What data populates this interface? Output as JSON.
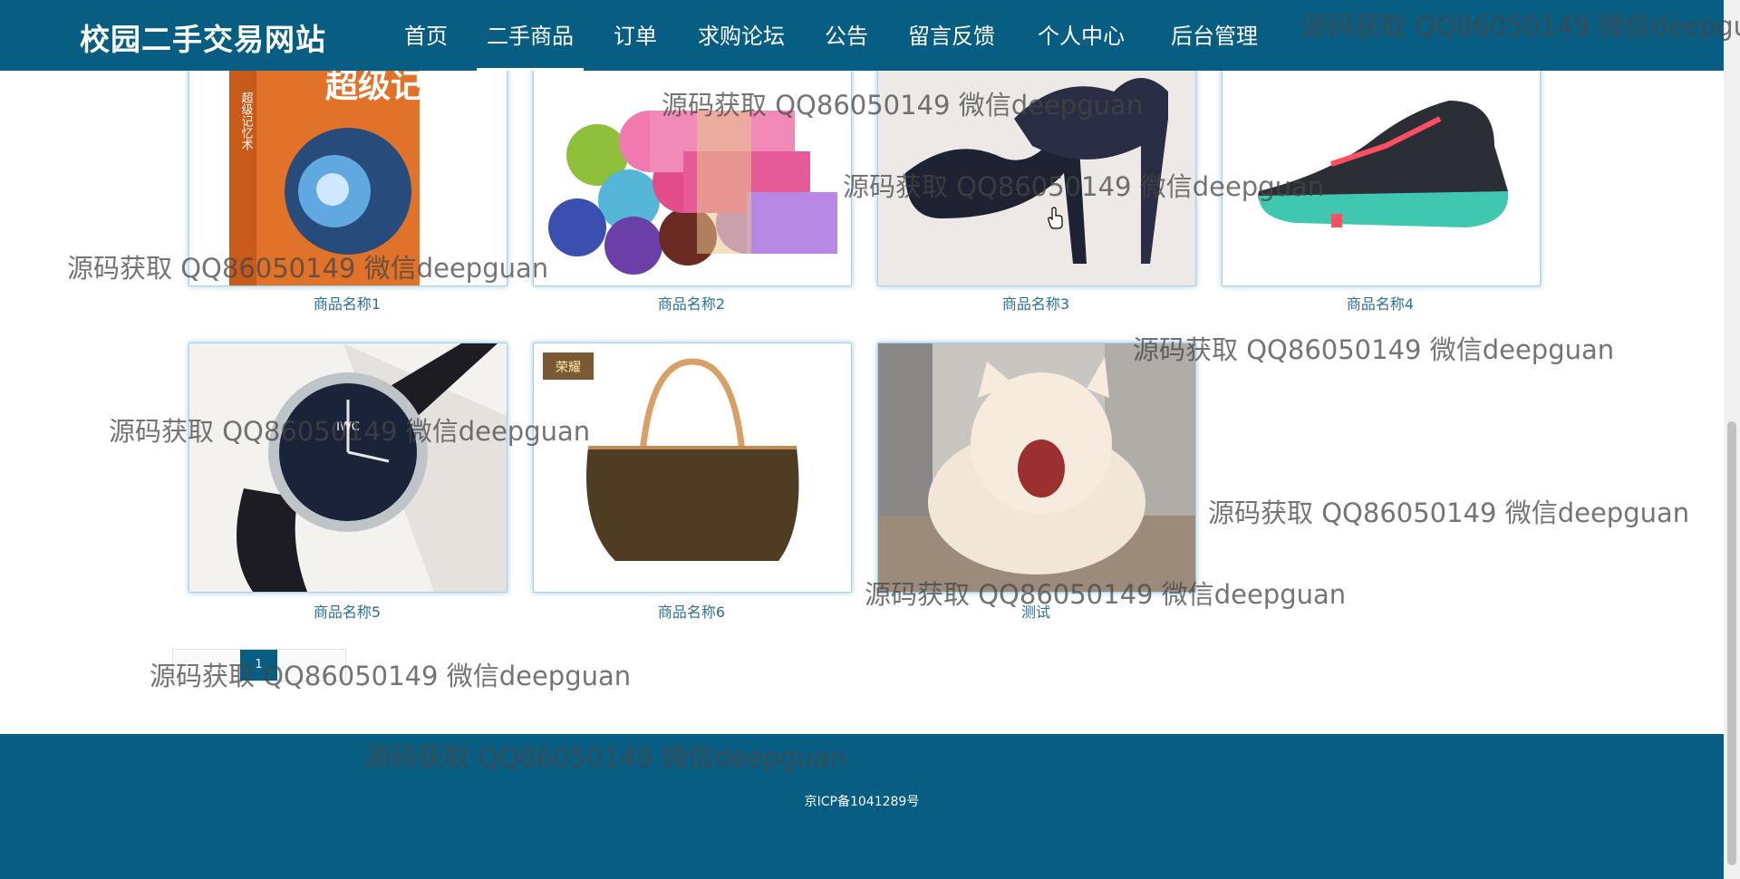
{
  "header": {
    "brand": "校园二手交易网站",
    "nav": [
      {
        "label": "首页"
      },
      {
        "label": "二手商品",
        "active": true
      },
      {
        "label": "订单"
      },
      {
        "label": "求购论坛"
      },
      {
        "label": "公告"
      },
      {
        "label": "留言反馈"
      },
      {
        "label": "个人中心"
      },
      {
        "label": "后台管理"
      }
    ]
  },
  "products": [
    {
      "name": "商品名称1",
      "image": "book-cover-image"
    },
    {
      "name": "商品名称2",
      "image": "yoga-mats-image"
    },
    {
      "name": "商品名称3",
      "image": "high-heels-image"
    },
    {
      "name": "商品名称4",
      "image": "sneaker-image"
    },
    {
      "name": "商品名称5",
      "image": "watch-image"
    },
    {
      "name": "商品名称6",
      "image": "handbag-image"
    },
    {
      "name": "测试",
      "image": "cat-image"
    }
  ],
  "images_text": {
    "book_title": "超级记忆术",
    "book_spine": "超级记忆术",
    "watch_brand": "IWC",
    "bag_logo": "荣耀"
  },
  "pagination": {
    "current": "1"
  },
  "footer": {
    "icp": "京ICP备1041289号"
  },
  "watermark": "源码获取 QQ86050149 微信deepguan",
  "colors": {
    "brand_blue": "#075d82",
    "link": "#2b6f96",
    "card_border": "#a9d0e6"
  }
}
